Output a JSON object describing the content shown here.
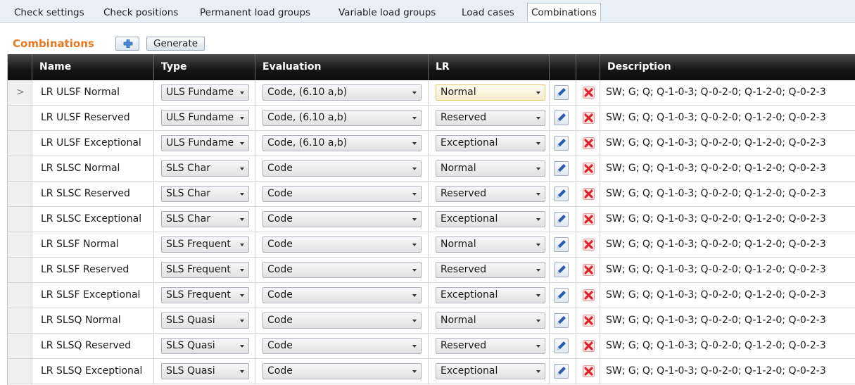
{
  "tabs": [
    {
      "label": "Check settings",
      "active": false
    },
    {
      "label": "Check positions",
      "active": false
    },
    {
      "label": "Permanent load groups",
      "active": false
    },
    {
      "label": "Variable load groups",
      "active": false
    },
    {
      "label": "Load cases",
      "active": false
    },
    {
      "label": "Combinations",
      "active": true
    }
  ],
  "toolbar": {
    "title": "Combinations",
    "add_icon": "plus-icon",
    "generate_label": "Generate"
  },
  "grid": {
    "columns": {
      "name": "Name",
      "type": "Type",
      "evaluation": "Evaluation",
      "lr": "LR",
      "edit": "",
      "delete": "",
      "description": "Description"
    },
    "rows": [
      {
        "selected": true,
        "name": "LR ULSF Normal",
        "type": "ULS Fundame",
        "evaluation": "Code, (6.10 a,b)",
        "lr": "Normal",
        "description": "SW; G; Q; Q-1-0-3; Q-0-2-0; Q-1-2-0; Q-0-2-3"
      },
      {
        "selected": false,
        "name": "LR ULSF Reserved",
        "type": "ULS Fundame",
        "evaluation": "Code, (6.10 a,b)",
        "lr": "Reserved",
        "description": "SW; G; Q; Q-1-0-3; Q-0-2-0; Q-1-2-0; Q-0-2-3"
      },
      {
        "selected": false,
        "name": "LR ULSF Exceptional",
        "type": "ULS Fundame",
        "evaluation": "Code, (6.10 a,b)",
        "lr": "Exceptional",
        "description": "SW; G; Q; Q-1-0-3; Q-0-2-0; Q-1-2-0; Q-0-2-3"
      },
      {
        "selected": false,
        "name": "LR SLSC Normal",
        "type": "SLS Char",
        "evaluation": "Code",
        "lr": "Normal",
        "description": "SW; G; Q; Q-1-0-3; Q-0-2-0; Q-1-2-0; Q-0-2-3"
      },
      {
        "selected": false,
        "name": "LR SLSC Reserved",
        "type": "SLS Char",
        "evaluation": "Code",
        "lr": "Reserved",
        "description": "SW; G; Q; Q-1-0-3; Q-0-2-0; Q-1-2-0; Q-0-2-3"
      },
      {
        "selected": false,
        "name": "LR SLSC Exceptional",
        "type": "SLS Char",
        "evaluation": "Code",
        "lr": "Exceptional",
        "description": "SW; G; Q; Q-1-0-3; Q-0-2-0; Q-1-2-0; Q-0-2-3"
      },
      {
        "selected": false,
        "name": "LR SLSF Normal",
        "type": "SLS Frequent",
        "evaluation": "Code",
        "lr": "Normal",
        "description": "SW; G; Q; Q-1-0-3; Q-0-2-0; Q-1-2-0; Q-0-2-3"
      },
      {
        "selected": false,
        "name": "LR SLSF Reserved",
        "type": "SLS Frequent",
        "evaluation": "Code",
        "lr": "Reserved",
        "description": "SW; G; Q; Q-1-0-3; Q-0-2-0; Q-1-2-0; Q-0-2-3"
      },
      {
        "selected": false,
        "name": "LR SLSF Exceptional",
        "type": "SLS Frequent",
        "evaluation": "Code",
        "lr": "Exceptional",
        "description": "SW; G; Q; Q-1-0-3; Q-0-2-0; Q-1-2-0; Q-0-2-3"
      },
      {
        "selected": false,
        "name": "LR SLSQ Normal",
        "type": "SLS Quasi",
        "evaluation": "Code",
        "lr": "Normal",
        "description": "SW; G; Q; Q-1-0-3; Q-0-2-0; Q-1-2-0; Q-0-2-3"
      },
      {
        "selected": false,
        "name": "LR SLSQ Reserved",
        "type": "SLS Quasi",
        "evaluation": "Code",
        "lr": "Reserved",
        "description": "SW; G; Q; Q-1-0-3; Q-0-2-0; Q-1-2-0; Q-0-2-3"
      },
      {
        "selected": false,
        "name": "LR SLSQ Exceptional",
        "type": "SLS Quasi",
        "evaluation": "Code",
        "lr": "Exceptional",
        "description": "SW; G; Q; Q-1-0-3; Q-0-2-0; Q-1-2-0; Q-0-2-3"
      }
    ],
    "selected_marker": ">",
    "edit_icon": "pencil-icon",
    "delete_icon": "delete-icon"
  },
  "colors": {
    "title_accent": "#e87722",
    "header_bg": "#111111",
    "delete_red": "#d9262b",
    "edit_blue": "#2a5db0"
  }
}
